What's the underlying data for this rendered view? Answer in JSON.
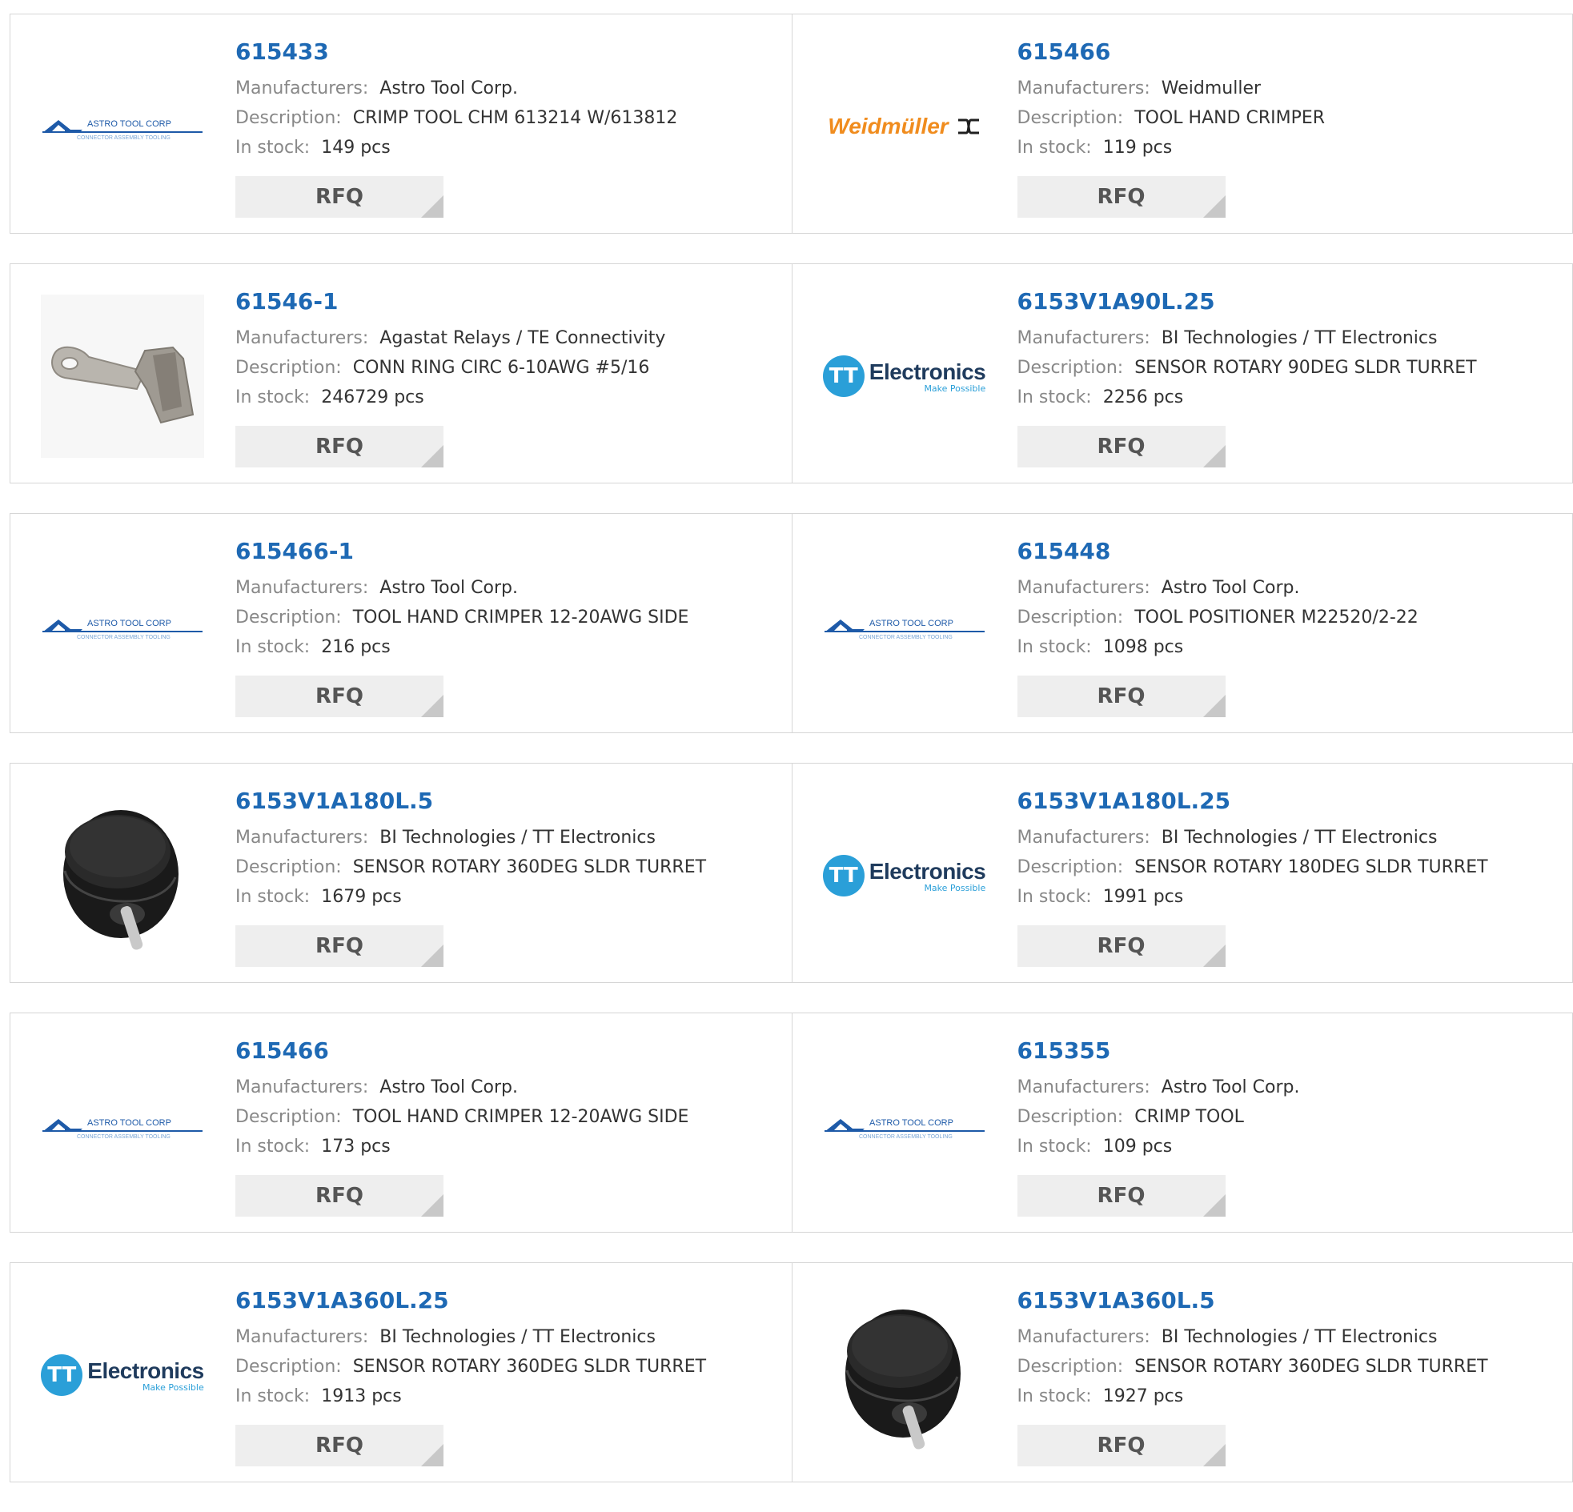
{
  "labels": {
    "manufacturers": "Manufacturers:",
    "description": "Description:",
    "stock": "In stock:",
    "rfq": "RFQ"
  },
  "products": [
    {
      "pn": "615433",
      "manufacturer": "Astro Tool Corp.",
      "description": "CRIMP TOOL CHM 613214 W/613812",
      "stock": "149 pcs",
      "image": "astro-tool-corp-logo"
    },
    {
      "pn": "615466",
      "manufacturer": "Weidmuller",
      "description": "TOOL HAND CRIMPER",
      "stock": "119 pcs",
      "image": "weidmuller-logo"
    },
    {
      "pn": "61546-1",
      "manufacturer": "Agastat Relays / TE Connectivity",
      "description": "CONN RING CIRC 6-10AWG #5/16",
      "stock": "246729 pcs",
      "image": "ring-terminal-photo"
    },
    {
      "pn": "6153V1A90L.25",
      "manufacturer": "BI Technologies / TT Electronics",
      "description": "SENSOR ROTARY 90DEG SLDR TURRET",
      "stock": "2256 pcs",
      "image": "tt-electronics-logo"
    },
    {
      "pn": "615466-1",
      "manufacturer": "Astro Tool Corp.",
      "description": "TOOL HAND CRIMPER 12-20AWG SIDE",
      "stock": "216 pcs",
      "image": "astro-tool-corp-logo"
    },
    {
      "pn": "615448",
      "manufacturer": "Astro Tool Corp.",
      "description": "TOOL POSITIONER M22520/2-22",
      "stock": "1098 pcs",
      "image": "astro-tool-corp-logo"
    },
    {
      "pn": "6153V1A180L.5",
      "manufacturer": "BI Technologies / TT Electronics",
      "description": "SENSOR ROTARY 360DEG SLDR TURRET",
      "stock": "1679 pcs",
      "image": "rotary-sensor-photo"
    },
    {
      "pn": "6153V1A180L.25",
      "manufacturer": "BI Technologies / TT Electronics",
      "description": "SENSOR ROTARY 180DEG SLDR TURRET",
      "stock": "1991 pcs",
      "image": "tt-electronics-logo"
    },
    {
      "pn": "615466",
      "manufacturer": "Astro Tool Corp.",
      "description": "TOOL HAND CRIMPER 12-20AWG SIDE",
      "stock": "173 pcs",
      "image": "astro-tool-corp-logo"
    },
    {
      "pn": "615355",
      "manufacturer": "Astro Tool Corp.",
      "description": "CRIMP TOOL",
      "stock": "109 pcs",
      "image": "astro-tool-corp-logo"
    },
    {
      "pn": "6153V1A360L.25",
      "manufacturer": "BI Technologies / TT Electronics",
      "description": "SENSOR ROTARY 360DEG SLDR TURRET",
      "stock": "1913 pcs",
      "image": "tt-electronics-logo"
    },
    {
      "pn": "6153V1A360L.5",
      "manufacturer": "BI Technologies / TT Electronics",
      "description": "SENSOR ROTARY 360DEG SLDR TURRET",
      "stock": "1927 pcs",
      "image": "rotary-sensor-photo"
    }
  ],
  "logos": {
    "astro_title": "ASTRO TOOL CORP",
    "astro_sub": "CONNECTOR ASSEMBLY TOOLING",
    "tt_mark": "TT",
    "tt_word": "Electronics",
    "tt_tag": "Make Possible",
    "weid_word": "Weidmüller"
  },
  "colors": {
    "link": "#1e69b4",
    "label": "#888888",
    "value": "#333333",
    "button_bg": "#eeeeee",
    "tt_blue": "#2a9fd8",
    "weid_orange": "#f08c1e"
  }
}
